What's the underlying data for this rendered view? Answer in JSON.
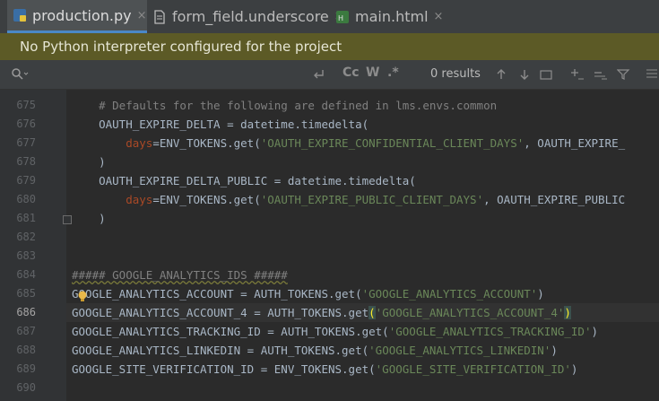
{
  "tabs": [
    {
      "label": "production.py",
      "active": true,
      "close": "×"
    },
    {
      "label": "form_field.underscore",
      "active": false,
      "close": "×"
    },
    {
      "label": "main.html",
      "active": false,
      "close": "×"
    }
  ],
  "banner": {
    "text": "No Python interpreter configured for the project"
  },
  "search": {
    "value": "",
    "results": "0 results",
    "match_case": "Cc",
    "words": "W",
    "regex": ".*"
  },
  "editor": {
    "current_line": "686",
    "lines": [
      {
        "num": "675",
        "text": "    # Defaults for the following are defined in lms.envs.common"
      },
      {
        "num": "676",
        "text": "    OAUTH_EXPIRE_DELTA = datetime.timedelta("
      },
      {
        "num": "677",
        "kw": "days",
        "before": "=ENV_TOKENS.get(",
        "str": "'OAUTH_EXPIRE_CONFIDENTIAL_CLIENT_DAYS'",
        "after": ", OAUTH_EXPIRE_"
      },
      {
        "num": "678",
        "text": "    )"
      },
      {
        "num": "679",
        "text": "    OAUTH_EXPIRE_DELTA_PUBLIC = datetime.timedelta("
      },
      {
        "num": "680",
        "kw": "days",
        "before": "=ENV_TOKENS.get(",
        "str": "'OAUTH_EXPIRE_PUBLIC_CLIENT_DAYS'",
        "after": ", OAUTH_EXPIRE_PUBLIC"
      },
      {
        "num": "681",
        "text": "    )"
      },
      {
        "num": "682",
        "text": ""
      },
      {
        "num": "683",
        "text": ""
      },
      {
        "num": "684",
        "text": "##### GOOGLE_ANALYTICS_IDS #####"
      },
      {
        "num": "685",
        "before": "GOOGLE_ANALYTICS_ACCOUNT = AUTH_TOKENS.get(",
        "str": "'GOOGLE_ANALYTICS_ACCOUNT'",
        "after": ")"
      },
      {
        "num": "686",
        "before": "GOOGLE_ANALYTICS_ACCOUNT_4 = AUTH_TOKENS.get",
        "lp": "(",
        "str": "'GOOGLE_ANALYTICS_ACCOUNT_4'",
        "rp": ")"
      },
      {
        "num": "687",
        "before": "GOOGLE_ANALYTICS_TRACKING_ID = AUTH_TOKENS.get(",
        "str": "'GOOGLE_ANALYTICS_TRACKING_ID'",
        "after": ")"
      },
      {
        "num": "688",
        "before": "GOOGLE_ANALYTICS_LINKEDIN = AUTH_TOKENS.get(",
        "str": "'GOOGLE_ANALYTICS_LINKEDIN'",
        "after": ")"
      },
      {
        "num": "689",
        "before": "GOOGLE_SITE_VERIFICATION_ID = ENV_TOKENS.get(",
        "str": "'GOOGLE_SITE_VERIFICATION_ID'",
        "after": ")"
      },
      {
        "num": "690",
        "text": ""
      }
    ]
  },
  "colors": {
    "accent": "#4a88c7",
    "banner": "#5c5a26",
    "string": "#6a8759",
    "keyword": "#aa4926",
    "comment": "#808080"
  }
}
